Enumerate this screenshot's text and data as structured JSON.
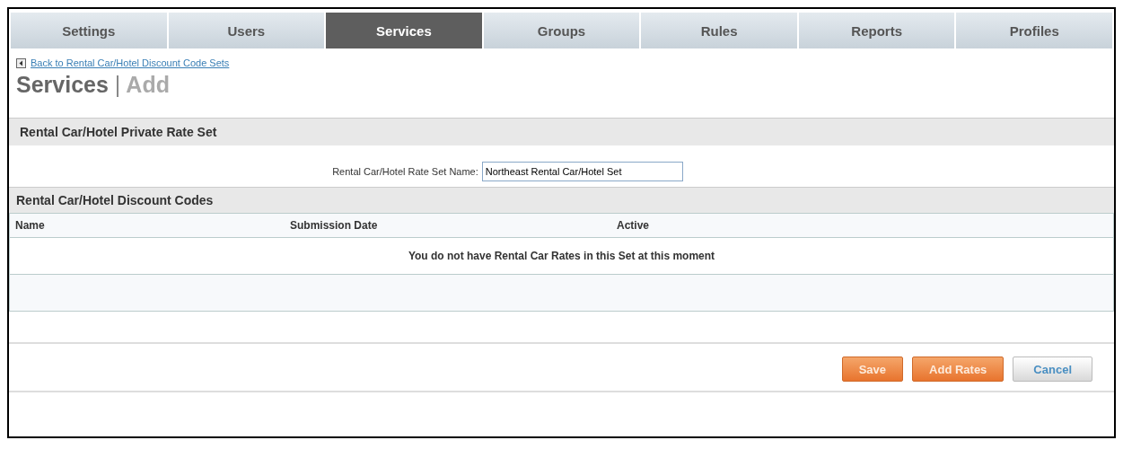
{
  "tabs": [
    {
      "label": "Settings",
      "selected": false
    },
    {
      "label": "Users",
      "selected": false
    },
    {
      "label": "Services",
      "selected": true
    },
    {
      "label": "Groups",
      "selected": false
    },
    {
      "label": "Rules",
      "selected": false
    },
    {
      "label": "Reports",
      "selected": false
    },
    {
      "label": "Profiles",
      "selected": false
    }
  ],
  "back_link": "Back to Rental Car/Hotel Discount Code Sets",
  "title": {
    "section": "Services",
    "separator": "|",
    "action": "Add"
  },
  "rate_set": {
    "header": "Rental Car/Hotel Private Rate Set",
    "field_label": "Rental Car/Hotel Rate Set Name:",
    "field_value": "Northeast Rental Car/Hotel Set"
  },
  "discount_codes": {
    "header": "Rental Car/Hotel Discount Codes",
    "columns": [
      "Name",
      "Submission Date",
      "Active"
    ],
    "empty_message": "You do not have Rental Car Rates in this Set at this moment"
  },
  "buttons": [
    {
      "label": "Save",
      "kind": "primary"
    },
    {
      "label": "Add Rates",
      "kind": "primary"
    },
    {
      "label": "Cancel",
      "kind": "secondary"
    }
  ]
}
